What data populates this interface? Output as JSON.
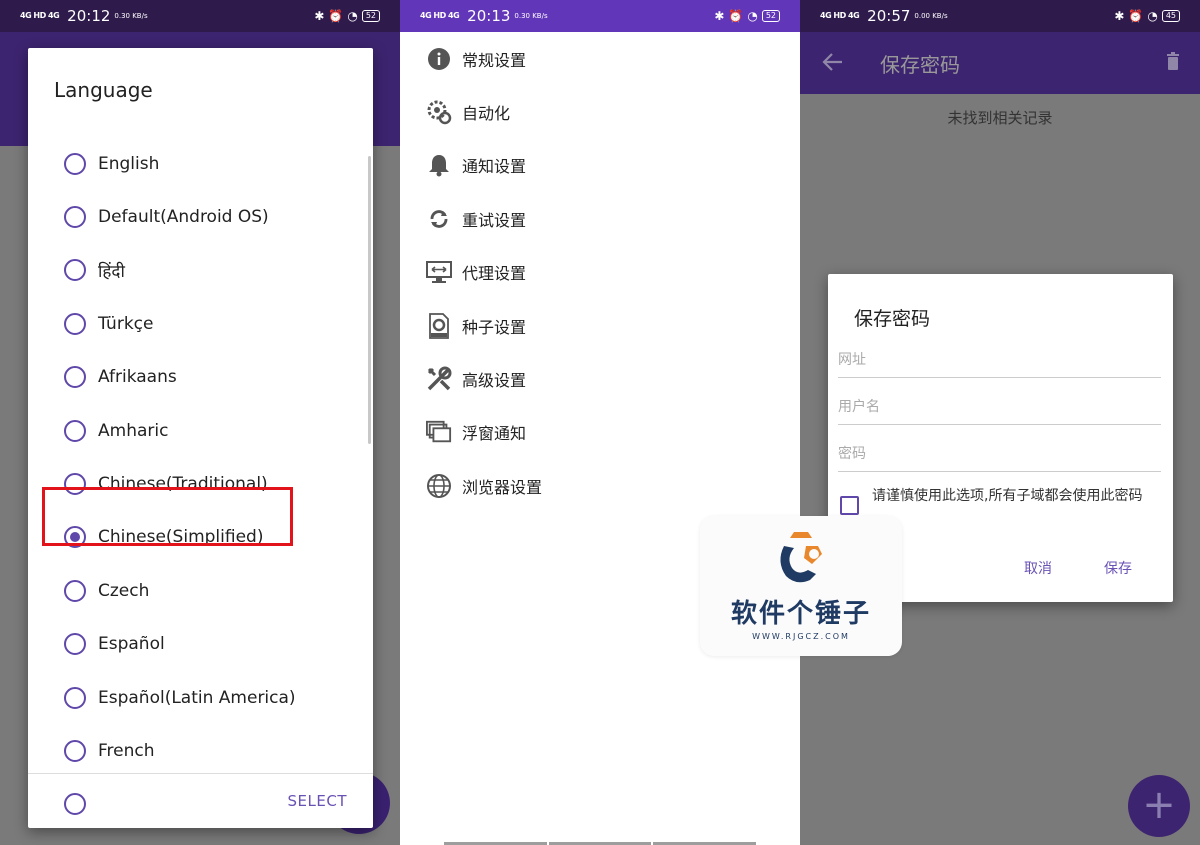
{
  "panel1": {
    "status": {
      "signal": "4G HD 4G",
      "time": "20:12",
      "speed": "0.30 KB/s",
      "battery": "52"
    },
    "dialog": {
      "title": "Language",
      "languages": [
        {
          "label": "English",
          "selected": false
        },
        {
          "label": "Default(Android OS)",
          "selected": false
        },
        {
          "label": "हिंदी",
          "selected": false
        },
        {
          "label": "Türkçe",
          "selected": false
        },
        {
          "label": "Afrikaans",
          "selected": false
        },
        {
          "label": "Amharic",
          "selected": false
        },
        {
          "label": "Chinese(Traditional)",
          "selected": false
        },
        {
          "label": "Chinese(Simplified)",
          "selected": true
        },
        {
          "label": "Czech",
          "selected": false
        },
        {
          "label": "Español",
          "selected": false
        },
        {
          "label": "Español(Latin America)",
          "selected": false
        },
        {
          "label": "French",
          "selected": false
        }
      ],
      "select_label": "SELECT"
    }
  },
  "panel2": {
    "status": {
      "signal": "4G HD 4G",
      "time": "20:13",
      "speed": "0.30 KB/s",
      "battery": "52"
    },
    "menu": [
      {
        "icon": "info-icon",
        "label": "常规设置"
      },
      {
        "icon": "automation-icon",
        "label": "自动化"
      },
      {
        "icon": "bell-icon",
        "label": "通知设置"
      },
      {
        "icon": "refresh-icon",
        "label": "重试设置"
      },
      {
        "icon": "proxy-icon",
        "label": "代理设置"
      },
      {
        "icon": "torrent-icon",
        "label": "种子设置"
      },
      {
        "icon": "wrench-icon",
        "label": "高级设置"
      },
      {
        "icon": "floating-window-icon",
        "label": "浮窗通知"
      },
      {
        "icon": "globe-icon",
        "label": "浏览器设置"
      }
    ]
  },
  "panel3": {
    "status": {
      "signal": "4G HD 4G",
      "time": "20:57",
      "speed": "0.00 KB/s",
      "battery": "45"
    },
    "appbar_title": "保存密码",
    "empty_text": "未找到相关记录",
    "dialog": {
      "title": "保存密码",
      "url_placeholder": "网址",
      "username_placeholder": "用户名",
      "password_placeholder": "密码",
      "checkbox_label": "请谨慎使用此选项,所有子域都会使用此密码",
      "cancel_label": "取消",
      "save_label": "保存"
    }
  },
  "watermark": {
    "text": "软件个锤子",
    "url": "WWW.RJGCZ.COM"
  },
  "colors": {
    "accent": "#5f48a9",
    "highlight": "#e3131b",
    "statusbar": "#6236b8"
  }
}
